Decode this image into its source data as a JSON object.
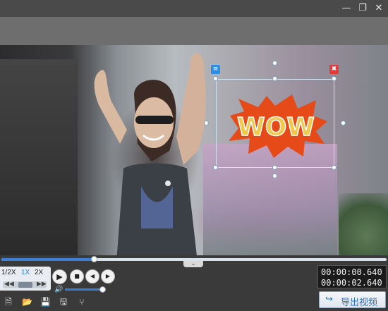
{
  "window": {
    "minimize_icon": "minimize-icon",
    "restore_icon": "restore-icon",
    "close_icon": "close-icon"
  },
  "sticker": {
    "text": "WOW",
    "colors": {
      "burst": "#e64a19",
      "letters": "#f2c84b",
      "outline": "#ffffff"
    },
    "list_icon": "list-icon",
    "delete_icon": "trash-icon",
    "list_color": "#2f8de4",
    "delete_color": "#e23b3b"
  },
  "playback": {
    "progress": 0.24,
    "collapse_icon": "chevron-down-icon",
    "speed_options": [
      "1/2X",
      "1X",
      "2X"
    ],
    "selected_speed": "1X",
    "volume": 0.95,
    "current_time": "00:00:00.640",
    "total_time": "00:00:02.640"
  },
  "toolbar": {
    "icons": [
      "new-file-icon",
      "open-folder-icon",
      "save-icon",
      "save-as-icon",
      "share-icon"
    ],
    "export_label": "导出视频",
    "export_icon": "export-icon"
  },
  "colors": {
    "accent": "#3b7fd6",
    "background": "#3a3a3a"
  }
}
